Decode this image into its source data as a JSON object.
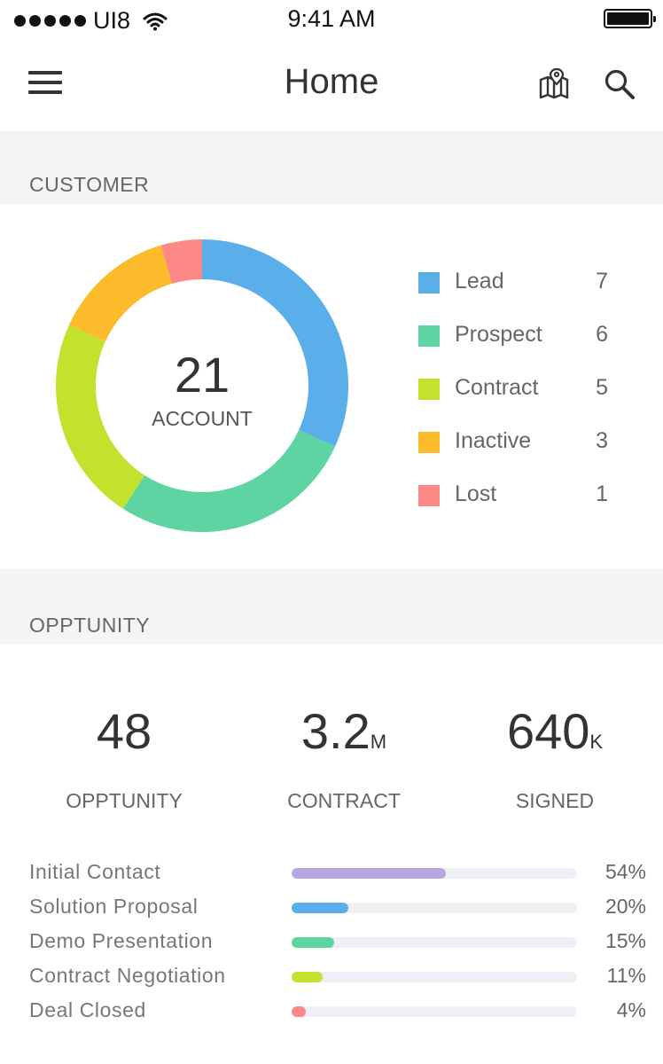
{
  "status_bar": {
    "carrier": "UI8",
    "time": "9:41 AM"
  },
  "nav": {
    "title": "Home",
    "menu_icon": "hamburger-menu-icon",
    "map_icon": "map-pin-icon",
    "search_icon": "search-icon"
  },
  "customer": {
    "section_title": "CUSTOMER",
    "total": "21",
    "total_label": "ACCOUNT",
    "segments": [
      {
        "label": "Lead",
        "count": "7",
        "value": 7,
        "color": "#5aaeea"
      },
      {
        "label": "Prospect",
        "count": "6",
        "value": 6,
        "color": "#5dd4a2"
      },
      {
        "label": "Contract",
        "count": "5",
        "value": 5,
        "color": "#c2e22e"
      },
      {
        "label": "Inactive",
        "count": "3",
        "value": 3,
        "color": "#fbbb2a"
      },
      {
        "label": "Lost",
        "count": "1",
        "value": 1,
        "color": "#fd8987"
      }
    ]
  },
  "opportunity": {
    "section_title": "OPPTUNITY",
    "stats": [
      {
        "value": "48",
        "unit": "",
        "label": "OPPTUNITY"
      },
      {
        "value": "3.2",
        "unit": "M",
        "label": "CONTRACT"
      },
      {
        "value": "640",
        "unit": "K",
        "label": "SIGNED"
      }
    ],
    "stages": [
      {
        "label": "Initial Contact",
        "pct_text": "54%",
        "fraction": 0.54,
        "color": "#b8a6e0"
      },
      {
        "label": "Solution Proposal",
        "pct_text": "20%",
        "fraction": 0.2,
        "color": "#5aaeea"
      },
      {
        "label": "Demo Presentation",
        "pct_text": "15%",
        "fraction": 0.15,
        "color": "#5dd4a2"
      },
      {
        "label": "Contract Negotiation",
        "pct_text": "11%",
        "fraction": 0.11,
        "color": "#c2e22e"
      },
      {
        "label": "Deal Closed",
        "pct_text": "4%",
        "fraction": 0.04,
        "color": "#fd8987"
      }
    ]
  }
}
